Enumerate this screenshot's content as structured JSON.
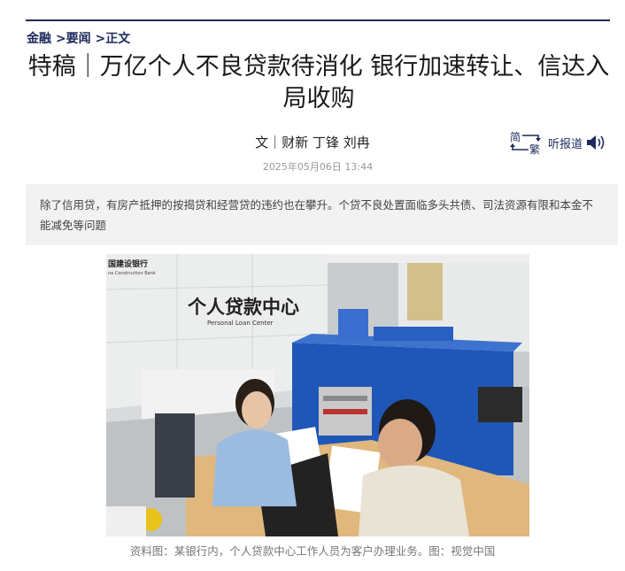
{
  "breadcrumb": {
    "items": [
      "金融",
      "要闻",
      "正文"
    ],
    "separator": ">"
  },
  "article": {
    "title": "特稿｜万亿个人不良贷款待消化 银行加速转让、信达入局收购",
    "byline": "文｜财新 丁锋 刘冉",
    "date": "2025年05月06日 13:44",
    "summary": "除了信用贷，有房产抵押的按揭贷和经营贷的违约也在攀升。个贷不良处置面临多头共债、司法资源有限和本金不能减免等问题",
    "image_caption": "资料图：某银行内，个人贷款中心工作人员为客户办理业务。图：视觉中国"
  },
  "tools": {
    "simplified": "简",
    "traditional": "繁",
    "listen": "听报道"
  },
  "photo_text": {
    "bank_name_cn": "国建设银行",
    "bank_name_en": "na Construction Bank",
    "center_cn": "个人贷款中心",
    "center_en": "Personal Loan Center"
  },
  "colors": {
    "accent": "#1d2a5c",
    "summary_bg": "#f2f2f2",
    "desk_blue": "#1f57b8"
  }
}
